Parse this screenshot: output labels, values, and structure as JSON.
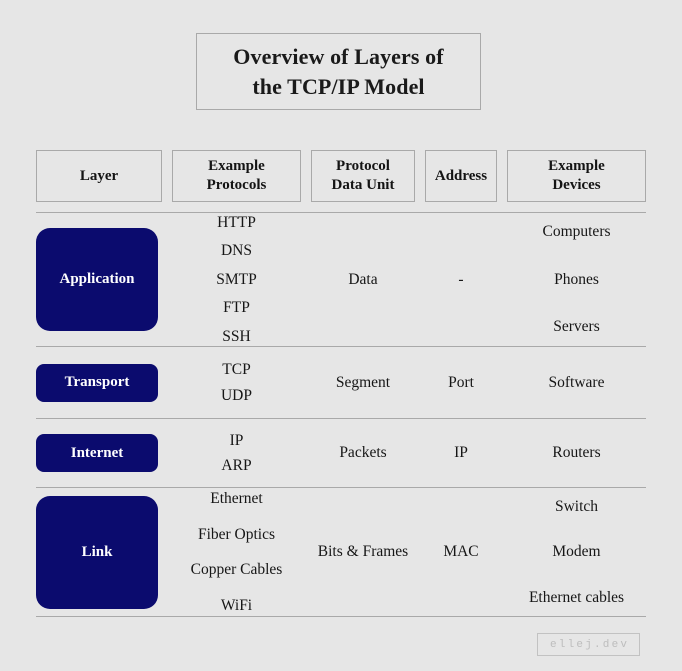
{
  "title": {
    "line1": "Overview of Layers of",
    "line2": "the TCP/IP Model"
  },
  "colors": {
    "background": "#e6e6e6",
    "layer_box": "#0b0b6e",
    "layer_box_text": "#ffffff",
    "border": "#a9a9a9",
    "text": "#161616",
    "badge_text": "#bdbdbd"
  },
  "headers": [
    {
      "id": "layer",
      "line1": "Layer",
      "line2": ""
    },
    {
      "id": "example-protocols",
      "line1": "Example",
      "line2": "Protocols"
    },
    {
      "id": "protocol-data-unit",
      "line1": "Protocol",
      "line2": "Data Unit"
    },
    {
      "id": "address",
      "line1": "Address",
      "line2": ""
    },
    {
      "id": "example-devices",
      "line1": "Example",
      "line2": "Devices"
    }
  ],
  "rows": [
    {
      "id": "application",
      "layer": "Application",
      "protocols": [
        "HTTP",
        "DNS",
        "SMTP",
        "FTP",
        "SSH"
      ],
      "pdu": [
        "Data"
      ],
      "address": [
        "-"
      ],
      "devices": [
        "Computers",
        "Phones",
        "Servers"
      ]
    },
    {
      "id": "transport",
      "layer": "Transport",
      "protocols": [
        "TCP",
        "UDP"
      ],
      "pdu": [
        "Segment"
      ],
      "address": [
        "Port"
      ],
      "devices": [
        "Software"
      ]
    },
    {
      "id": "internet",
      "layer": "Internet",
      "protocols": [
        "IP",
        "ARP"
      ],
      "pdu": [
        "Packets"
      ],
      "address": [
        "IP"
      ],
      "devices": [
        "Routers"
      ]
    },
    {
      "id": "link",
      "layer": "Link",
      "protocols": [
        "Ethernet",
        "Fiber Optics",
        "Copper Cables",
        "WiFi"
      ],
      "pdu": [
        "Bits & Frames"
      ],
      "address": [
        "MAC"
      ],
      "devices": [
        "Switch",
        "Modem",
        "Ethernet cables"
      ]
    }
  ],
  "footer": {
    "badge": "ellej.dev"
  }
}
